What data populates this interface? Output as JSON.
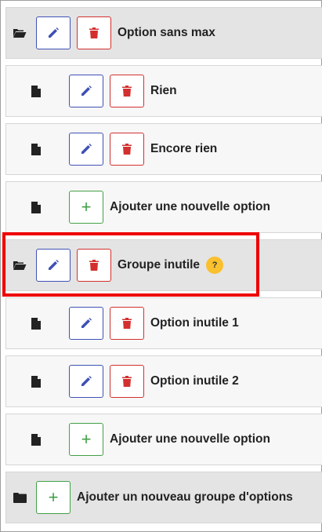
{
  "rows": [
    {
      "label": "Option sans max"
    },
    {
      "label": "Rien"
    },
    {
      "label": "Encore rien"
    },
    {
      "label": "Ajouter une nouvelle option"
    },
    {
      "label": "Groupe inutile",
      "help": "?"
    },
    {
      "label": "Option inutile 1"
    },
    {
      "label": "Option inutile 2"
    },
    {
      "label": "Ajouter une nouvelle option"
    },
    {
      "label": "Ajouter un nouveau groupe d'options"
    }
  ],
  "colors": {
    "edit": "#3f51b5",
    "delete": "#d32f2f",
    "add": "#43a047",
    "help_badge": "#fbc02d",
    "highlight": "#ee0000"
  },
  "icons": {
    "group": "folder-open-icon",
    "option": "file-icon",
    "edit": "pencil-icon",
    "delete": "trash-icon",
    "add": "plus-icon",
    "new_group": "folder-icon"
  }
}
